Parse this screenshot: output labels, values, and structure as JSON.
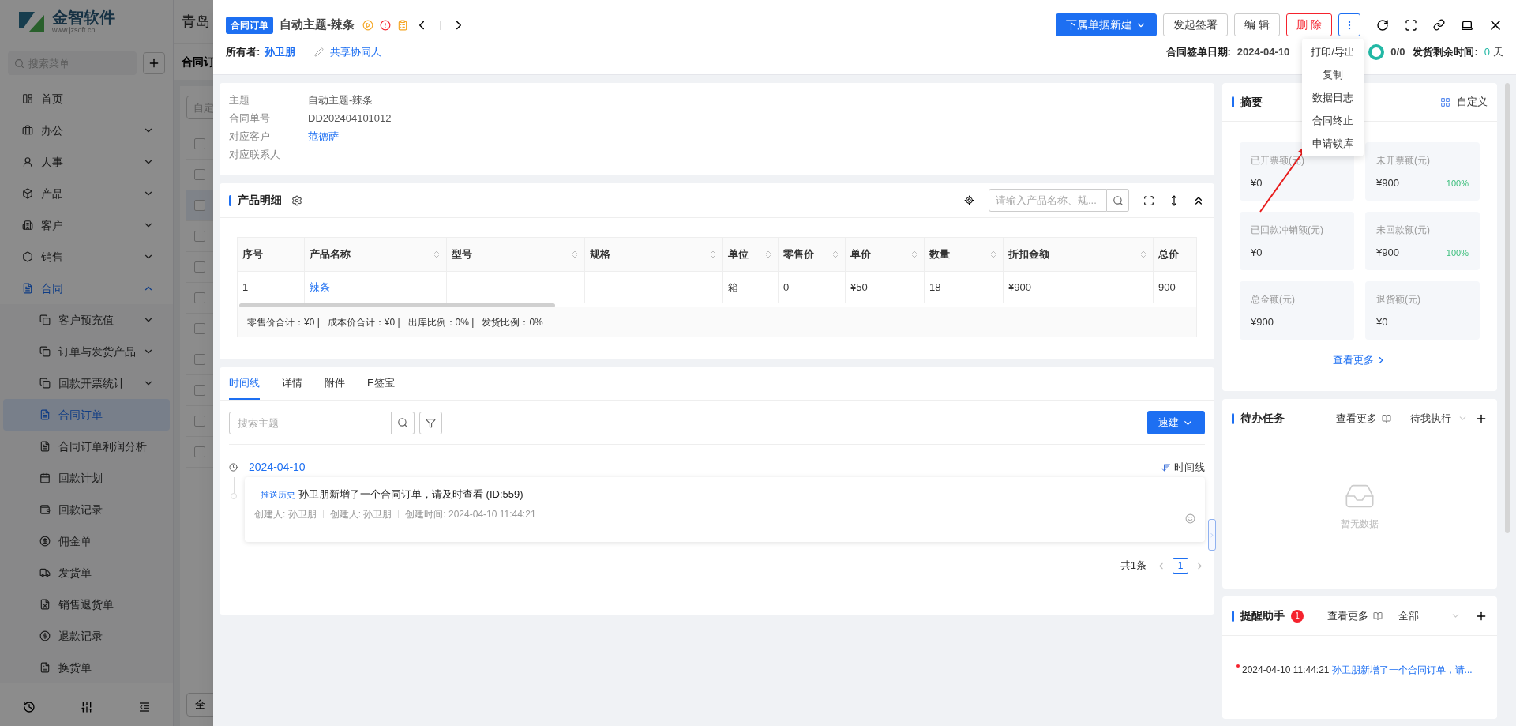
{
  "background_app": {
    "logo_name": "金智软件",
    "logo_url": "www.jzsoft.cn",
    "company_title": "青岛",
    "search_placeholder": "搜索菜单",
    "menu": [
      {
        "label": "首页",
        "selected": false
      },
      {
        "label": "办公",
        "selected": false,
        "expanded": false
      },
      {
        "label": "人事",
        "selected": false,
        "expanded": false
      },
      {
        "label": "产品",
        "selected": false,
        "expanded": false
      },
      {
        "label": "客户",
        "selected": false,
        "expanded": false
      },
      {
        "label": "销售",
        "selected": false,
        "expanded": false
      },
      {
        "label": "合同",
        "selected": true,
        "expanded": true,
        "children": [
          {
            "label": "客户预充值",
            "selected": false,
            "expanded": false
          },
          {
            "label": "订单与发货产品",
            "selected": false,
            "expanded": false
          },
          {
            "label": "回款开票统计",
            "selected": false,
            "expanded": false
          },
          {
            "label": "合同订单",
            "selected": true
          },
          {
            "label": "合同订单利润分析",
            "selected": false
          },
          {
            "label": "回款计划",
            "selected": false
          },
          {
            "label": "回款记录",
            "selected": false
          },
          {
            "label": "佣金单",
            "selected": false
          },
          {
            "label": "发货单",
            "selected": false
          },
          {
            "label": "销售退货单",
            "selected": false
          },
          {
            "label": "退款记录",
            "selected": false
          },
          {
            "label": "换货单",
            "selected": false
          }
        ]
      }
    ],
    "page_tab": "合同订",
    "filter_placeholder": "自定",
    "rows": [
      {
        "checked": false,
        "selected": false
      },
      {
        "checked": false,
        "selected": false
      },
      {
        "checked": false,
        "selected": true
      },
      {
        "checked": false,
        "selected": false
      },
      {
        "checked": false,
        "selected": false
      },
      {
        "checked": false,
        "selected": false
      },
      {
        "checked": false,
        "selected": false
      },
      {
        "checked": false,
        "selected": false
      },
      {
        "checked": false,
        "selected": false
      },
      {
        "checked": false,
        "selected": false
      },
      {
        "checked": false,
        "selected": false
      }
    ],
    "bottom_button": "全"
  },
  "drawer": {
    "badge": "合同订单",
    "title": "自动主题-辣条",
    "owner_label": "所有者:",
    "owner": "孙卫朋",
    "share_link": "共享协同人",
    "actions": [
      {
        "label": "下属单据新建",
        "kind": "primary"
      },
      {
        "label": "发起签署",
        "kind": "default"
      },
      {
        "label": "编 辑",
        "kind": "default"
      },
      {
        "label": "删 除",
        "kind": "danger"
      }
    ],
    "more_menu": {
      "open": true,
      "items": [
        "打印/导出",
        "复制",
        "数据日志",
        "合同终止",
        "申请锁库"
      ]
    },
    "sign_date_label": "合同签单日期:",
    "sign_date": "2024-04-10",
    "progress": "0/0",
    "ship_label": "发货剩余时间:",
    "ship_days": "0",
    "ship_unit": "天"
  },
  "info": [
    {
      "label": "主题",
      "value": "自动主题-辣条",
      "link": false
    },
    {
      "label": "合同单号",
      "value": "DD202404101012",
      "link": false
    },
    {
      "label": "对应客户",
      "value": "范德萨",
      "link": true
    },
    {
      "label": "对应联系人"
    }
  ],
  "products": {
    "title": "产品明细",
    "search_placeholder": "请输入产品名称、规...",
    "columns": [
      {
        "label": "序号",
        "sortable": false
      },
      {
        "label": "产品名称",
        "sortable": true
      },
      {
        "label": "型号",
        "sortable": true
      },
      {
        "label": "规格",
        "sortable": true
      },
      {
        "label": "单位",
        "sortable": true
      },
      {
        "label": "零售价",
        "sortable": true
      },
      {
        "label": "单价",
        "sortable": true
      },
      {
        "label": "数量",
        "sortable": true
      },
      {
        "label": "折扣金额",
        "sortable": true
      },
      {
        "label": "总价",
        "sortable": false
      }
    ],
    "rows": [
      [
        "1",
        "辣条",
        "",
        "",
        "箱",
        "0",
        "¥50",
        "18",
        "¥900",
        "900"
      ]
    ],
    "totals": "零售价合计：¥0 |   成本价合计：¥0 |   出库比例：0% |   发货比例：0%"
  },
  "timeline": {
    "tabs": [
      {
        "label": "时间线",
        "selected": true
      },
      {
        "label": "详情",
        "selected": false
      },
      {
        "label": "附件",
        "selected": false
      },
      {
        "label": "E签宝",
        "selected": false
      }
    ],
    "search_placeholder": "搜索主题",
    "quick_button": "速建",
    "date": "2024-04-10",
    "view_toggle": "时间线",
    "entries": [
      {
        "tag": "推送历史",
        "text": "孙卫朋新增了一个合同订单，请及时查看 (ID:559)",
        "meta": [
          "创建人: 孙卫朋",
          "创建人: 孙卫朋",
          "创建时间: 2024-04-10 11:44:21"
        ]
      }
    ],
    "total": "共1条",
    "pages": [
      {
        "label": "1",
        "selected": true
      }
    ]
  },
  "summary": {
    "title": "摘要",
    "customize": "自定义",
    "tiles": [
      {
        "label": "已开票额(元)",
        "value": "¥0"
      },
      {
        "label": "未开票额(元)",
        "value": "¥900",
        "percent": "100%"
      },
      {
        "label": "已回款冲销额(元)",
        "value": "¥0"
      },
      {
        "label": "未回款额(元)",
        "value": "¥900",
        "percent": "100%"
      },
      {
        "label": "总金额(元)",
        "value": "¥900"
      },
      {
        "label": "退货额(元)",
        "value": "¥0"
      }
    ],
    "more": "查看更多"
  },
  "todo": {
    "title": "待办任务",
    "more": "查看更多",
    "filter": "待我执行",
    "empty": "暂无数据"
  },
  "reminders": {
    "title": "提醒助手",
    "count": "1",
    "more": "查看更多",
    "filter": "全部",
    "items": [
      {
        "time": "2024-04-10 11:44:21",
        "text": "孙卫朋新增了一个合同订单，请..."
      }
    ]
  }
}
